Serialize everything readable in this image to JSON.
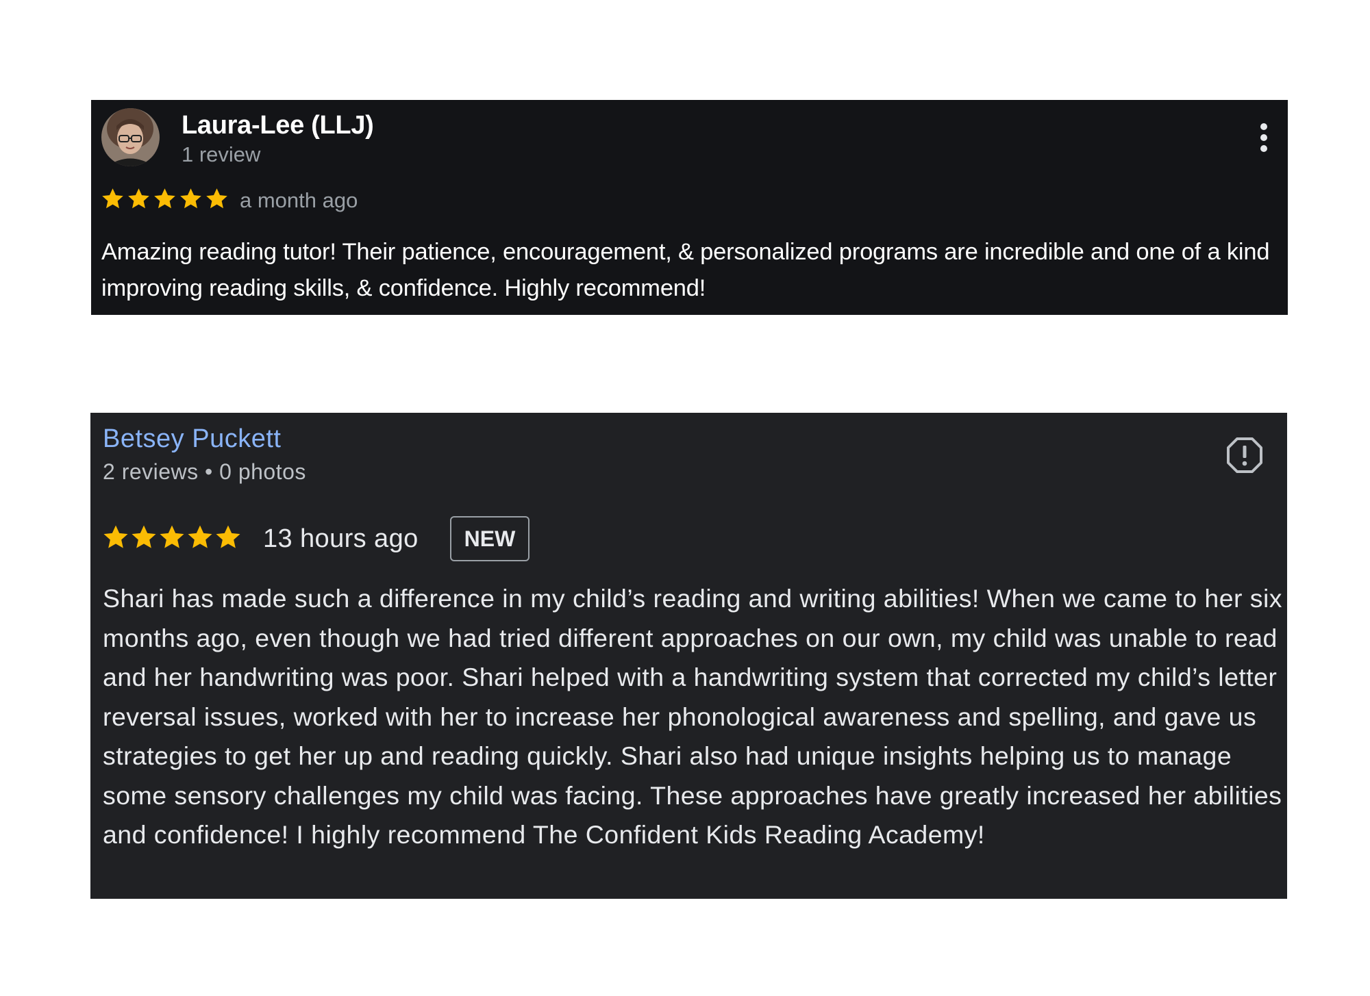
{
  "review1": {
    "author_name": "Laura-Lee (LLJ)",
    "review_count": "1 review",
    "rating": 5,
    "time": "a month ago",
    "text": "Amazing reading tutor! Their patience, encouragement, & personalized programs are incredible and one of a kind improving reading skills, & confidence. Highly recommend!",
    "avatar_icon": "user-photo",
    "menu_icon": "more-vert-icon"
  },
  "review2": {
    "author_name": "Betsey Puckett",
    "meta": "2 reviews • 0 photos",
    "rating": 5,
    "time": "13 hours ago",
    "badge": "NEW",
    "text": "Shari has made such a difference in my child’s reading and writing abilities! When we came to her six months ago, even though we had tried different approaches on our own, my child was unable to read and her handwriting was poor. Shari helped with a handwriting system that corrected my child’s letter reversal issues, worked with her to increase her phonological awareness and spelling, and gave us strategies to get her up and reading quickly. Shari also had unique insights helping us to manage some sensory challenges my child was facing. These approaches have greatly increased her abilities and confidence! I highly recommend The Confident Kids Reading Academy!",
    "flag_icon": "report-icon"
  },
  "colors": {
    "star": "#fbbc04",
    "card1_bg": "#131417",
    "card2_bg": "#202124",
    "link": "#8ab4f8"
  }
}
